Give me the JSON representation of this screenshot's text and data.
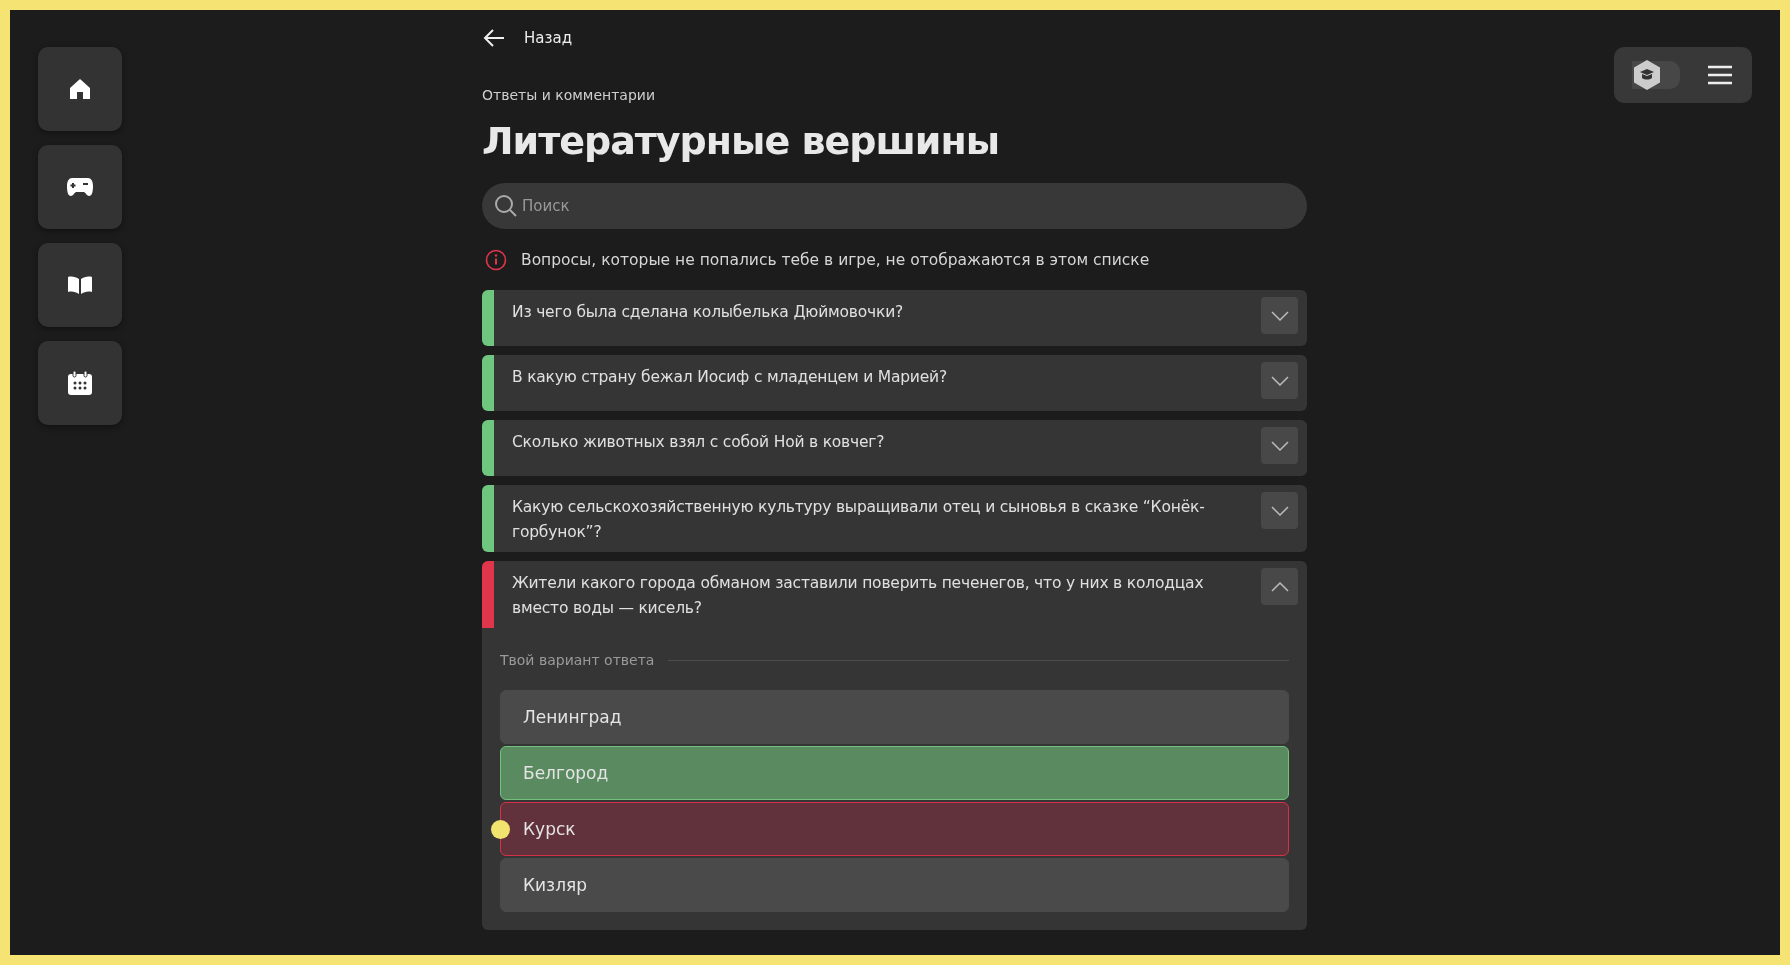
{
  "nav": [
    {
      "kind": "home",
      "selected": false
    },
    {
      "kind": "games",
      "selected": false
    },
    {
      "kind": "library",
      "selected": false
    },
    {
      "kind": "calendar",
      "selected": false
    }
  ],
  "back": {
    "label": "Назад"
  },
  "breadcrumb": "Ответы и комментарии",
  "title": "Литературные вершины",
  "search": {
    "placeholder": "Поиск"
  },
  "notice": "Вопросы, которые не попались тебе в игре, не отображаются в этом списке",
  "top_right": {
    "mode_toggle_on": false
  },
  "questions": [
    {
      "text": "Из чего была сделана колыбелька Дюймовочки?",
      "correct": true,
      "expanded": false
    },
    {
      "text": "В какую страну бежал Иосиф с младенцем и Марией?",
      "correct": true,
      "expanded": false
    },
    {
      "text": "Сколько животных взял с собой Ной в ковчег?",
      "correct": true,
      "expanded": false
    },
    {
      "text": "Какую сельскохозяйственную культуру выращивали отец и сыновья в сказке “Конёк-горбунок”?",
      "correct": true,
      "expanded": false
    },
    {
      "text": "Жители какого города обманом заставили поверить печенегов, что у них в колодцах вместо воды — кисель?",
      "correct": false,
      "expanded": true,
      "answers_label": "Твой вариант ответа",
      "answers": [
        {
          "text": "Ленинград",
          "kind": "neutral",
          "selected": false
        },
        {
          "text": "Белгород",
          "kind": "correct",
          "selected": false
        },
        {
          "text": "Курск",
          "kind": "wrong",
          "selected": true
        },
        {
          "text": "Кизляр",
          "kind": "neutral",
          "selected": false
        }
      ]
    }
  ]
}
